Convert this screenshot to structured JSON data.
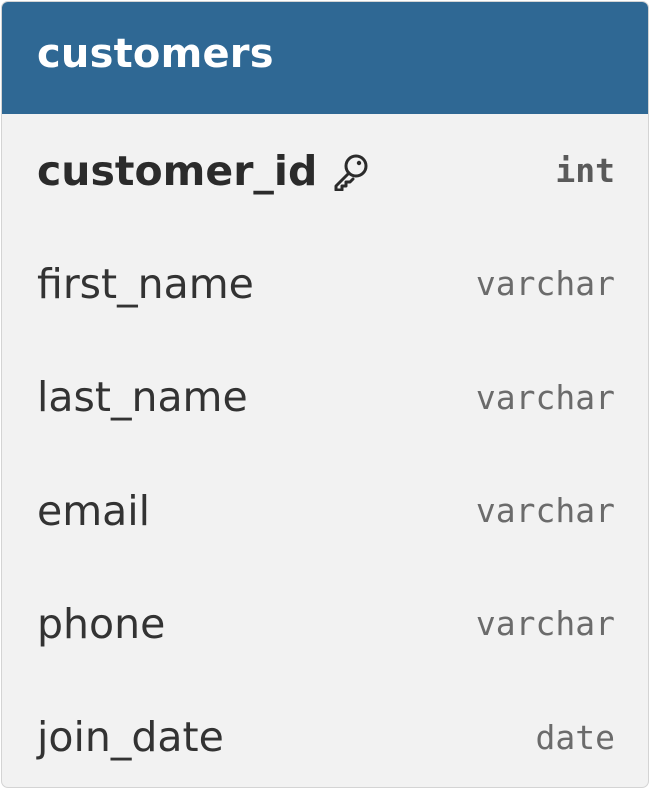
{
  "table": {
    "title": "customers",
    "columns": [
      {
        "name": "customer_id",
        "type": "int",
        "primary_key": true,
        "icon": "key-icon"
      },
      {
        "name": "first_name",
        "type": "varchar",
        "primary_key": false
      },
      {
        "name": "last_name",
        "type": "varchar",
        "primary_key": false
      },
      {
        "name": "email",
        "type": "varchar",
        "primary_key": false
      },
      {
        "name": "phone",
        "type": "varchar",
        "primary_key": false
      },
      {
        "name": "join_date",
        "type": "date",
        "primary_key": false
      }
    ]
  },
  "colors": {
    "header_background": "#2f6894",
    "header_text": "#ffffff",
    "body_background": "#f2f2f2",
    "column_text": "#333333",
    "type_text": "#6b6b6b"
  }
}
